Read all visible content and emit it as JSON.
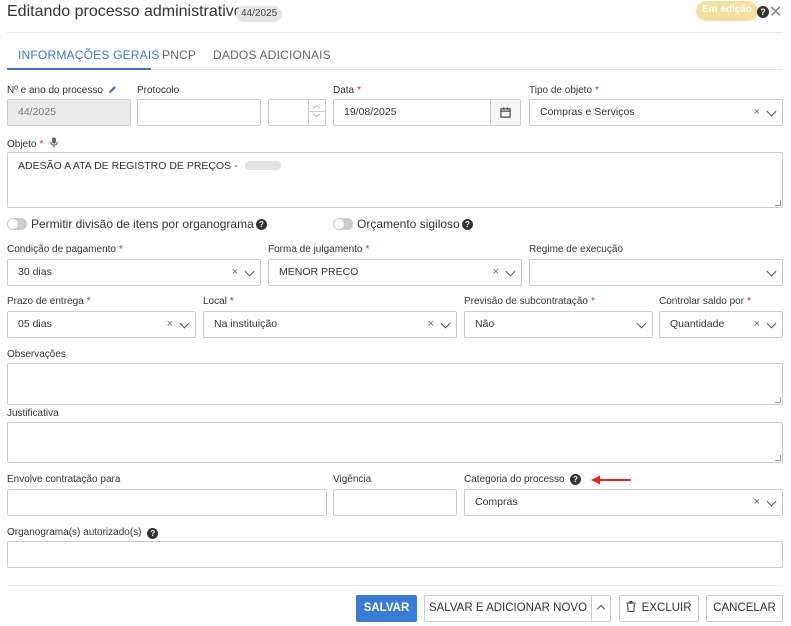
{
  "header": {
    "title": "Editando processo administrativo",
    "number_badge": "44/2025",
    "status_badge": "Em edição",
    "help_icon": "question-circle-icon",
    "close_icon": "x-icon"
  },
  "tabs": [
    {
      "label": "INFORMAÇÕES GERAIS"
    },
    {
      "label": "PNCP"
    },
    {
      "label": "DADOS ADICIONAIS"
    }
  ],
  "form": {
    "numero": {
      "label": "Nº e ano do processo",
      "value": "44/2025"
    },
    "protocolo": {
      "label": "Protocolo",
      "value": ""
    },
    "data": {
      "label": "Data",
      "value": "19/08/2025"
    },
    "tipo_objeto": {
      "label": "Tipo de objeto",
      "value": "Compras e Serviços"
    },
    "objeto": {
      "label": "Objeto",
      "value": "ADESÃO A ATA DE REGISTRO DE PREÇOS -"
    },
    "permitir_divisao": {
      "label": "Permitir divisão de itens por organograma"
    },
    "orcamento_sigiloso": {
      "label": "Orçamento sigiloso"
    },
    "condicao_pagamento": {
      "label": "Condição de pagamento",
      "value": "30 dias"
    },
    "forma_julgamento": {
      "label": "Forma de julgamento",
      "value": "MENOR PRECO"
    },
    "regime_execucao": {
      "label": "Regime de execução",
      "value": ""
    },
    "prazo_entrega": {
      "label": "Prazo de entrega",
      "value": "05 dias"
    },
    "local": {
      "label": "Local",
      "value": "Na instituição"
    },
    "previsao_subcontratacao": {
      "label": "Previsão de subcontratação",
      "value": "Não"
    },
    "controlar_saldo": {
      "label": "Controlar saldo por",
      "value": "Quantidade"
    },
    "observacoes": {
      "label": "Observações",
      "value": ""
    },
    "justificativa": {
      "label": "Justificativa",
      "value": ""
    },
    "envolve_contratacao": {
      "label": "Envolve contratação para",
      "value": ""
    },
    "vigencia": {
      "label": "Vigência",
      "value": ""
    },
    "categoria_processo": {
      "label": "Categoria do processo",
      "value": "Compras"
    },
    "organogramas": {
      "label": "Organograma(s) autorizado(s)",
      "value": ""
    }
  },
  "required_mark": "*",
  "clear_glyph": "×",
  "buttons": {
    "salvar": "SALVAR",
    "salvar_adicionar": "SALVAR E ADICIONAR NOVO",
    "excluir": "EXCLUIR",
    "cancelar": "CANCELAR"
  },
  "colors": {
    "accent": "#3a78c2",
    "primary_button": "#3a7bd5",
    "required": "#d9232e",
    "annotation_arrow": "#e8231f",
    "status_badge": "#f5dfa0"
  }
}
